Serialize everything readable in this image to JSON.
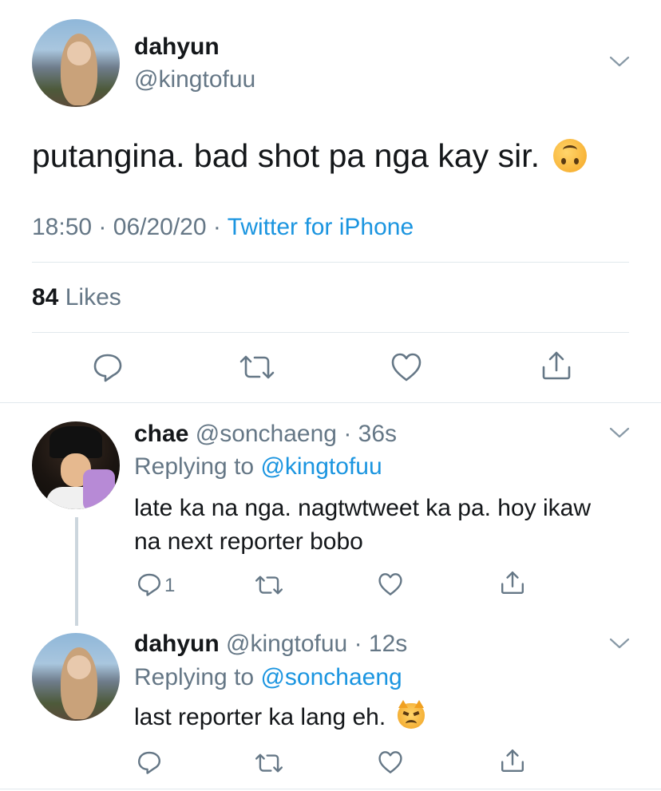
{
  "main_tweet": {
    "display_name": "dahyun",
    "handle": "@kingtofuu",
    "text": "putangina. bad shot pa nga kay sir.",
    "emoji": "upside-down-face",
    "time": "18:50",
    "date": "06/20/20",
    "separator": "·",
    "source": "Twitter for iPhone",
    "likes_count": "84",
    "likes_label": "Likes"
  },
  "replies": [
    {
      "display_name": "chae",
      "handle": "@sonchaeng",
      "age": "36s",
      "replying_prefix": "Replying to",
      "replying_to": "@kingtofuu",
      "text_line1": "late ka na nga. nagtwtweet ka pa. hoy ikaw",
      "text_line2": "na next reporter bobo",
      "reply_count": "1"
    },
    {
      "display_name": "dahyun",
      "handle": "@kingtofuu",
      "age": "12s",
      "replying_prefix": "Replying to",
      "replying_to": "@sonchaeng",
      "text": "last reporter ka lang eh.",
      "emoji": "pouting-cat-face"
    }
  ],
  "colors": {
    "link": "#1b95e0",
    "secondary_text": "#657786",
    "divider": "#e1e8ed",
    "icon": "#657786"
  }
}
